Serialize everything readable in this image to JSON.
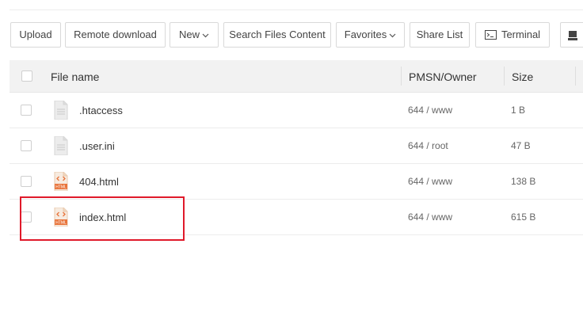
{
  "toolbar": {
    "upload": "Upload",
    "remote_download": "Remote download",
    "new": "New",
    "search": "Search Files Content",
    "favorites": "Favorites",
    "share_list": "Share List",
    "terminal": "Terminal"
  },
  "table": {
    "headers": {
      "name": "File name",
      "perm": "PMSN/Owner",
      "size": "Size"
    },
    "rows": [
      {
        "name": ".htaccess",
        "perm": "644 / www",
        "size": "1 B",
        "type": "text"
      },
      {
        "name": ".user.ini",
        "perm": "644 / root",
        "size": "47 B",
        "type": "text"
      },
      {
        "name": "404.html",
        "perm": "644 / www",
        "size": "138 B",
        "type": "html"
      },
      {
        "name": "index.html",
        "perm": "644 / www",
        "size": "615 B",
        "type": "html"
      }
    ]
  },
  "icons": {
    "text_file": "text-file-icon",
    "html_file": "html-file-icon",
    "html_badge": "HTML"
  },
  "colors": {
    "highlight": "#e0192a",
    "html_icon": "#e8743b"
  }
}
